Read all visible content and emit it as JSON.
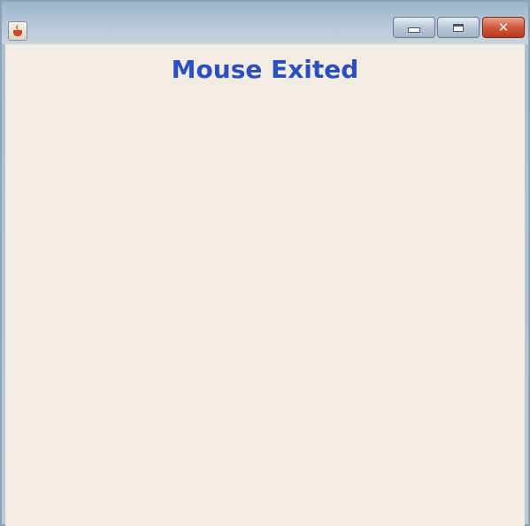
{
  "window": {
    "icon": "java-cup-icon",
    "controls": {
      "minimize_icon": "minimize-icon",
      "maximize_icon": "maximize-icon",
      "close_icon": "close-icon",
      "close_glyph": "✕"
    }
  },
  "content": {
    "status_text": "Mouse Exited",
    "status_color": "#2b4fbf",
    "background_color": "#f3ece2"
  }
}
